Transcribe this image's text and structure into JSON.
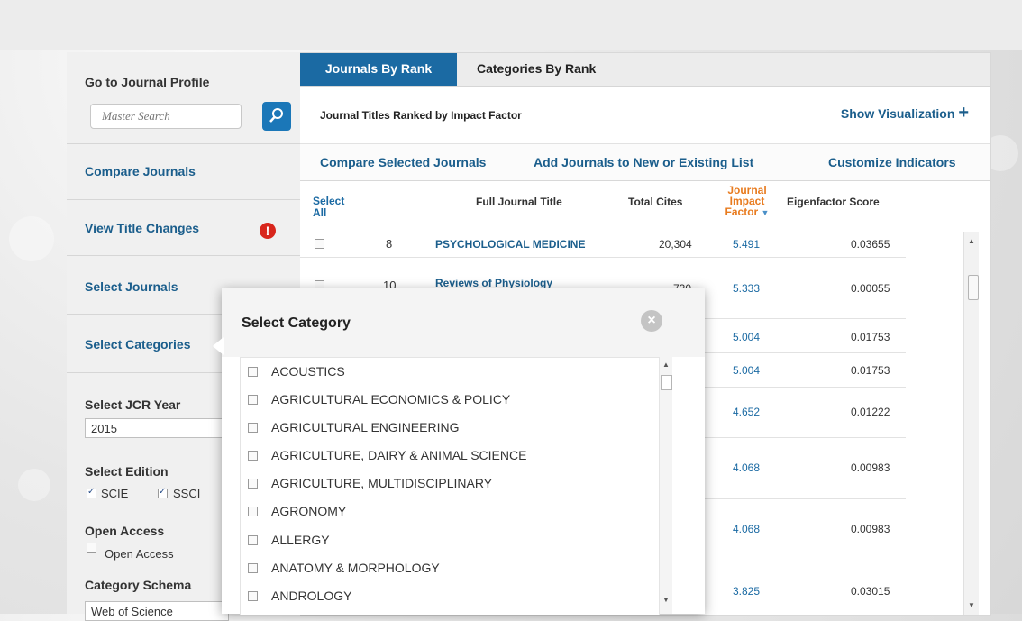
{
  "sidebar": {
    "go_to_profile": "Go to Journal Profile",
    "search_placeholder": "Master Search",
    "compare_journals": "Compare Journals",
    "view_title_changes": "View Title Changes",
    "select_journals": "Select Journals",
    "select_categories": "Select Categories",
    "jcr_year_label": "Select JCR Year",
    "jcr_year_value": "2015",
    "edition_label": "Select Edition",
    "editions": [
      {
        "label": "SCIE",
        "checked": true
      },
      {
        "label": "SSCI",
        "checked": true
      }
    ],
    "open_access_label": "Open Access",
    "open_access_option": "Open Access",
    "category_schema_label": "Category Schema",
    "category_schema_value": "Web of Science"
  },
  "tabs": {
    "active": "Journals By Rank",
    "other": "Categories By Rank"
  },
  "subtitle": "Journal Titles Ranked by Impact Factor",
  "show_visualization": "Show Visualization",
  "actions": {
    "compare": "Compare Selected Journals",
    "add": "Add Journals to New or Existing List",
    "customize": "Customize Indicators"
  },
  "table": {
    "headers": {
      "select": "Select",
      "all": "All",
      "title": "Full Journal Title",
      "cites": "Total Cites",
      "jif_line1": "Journal",
      "jif_line2": "Impact",
      "jif_line3": "Factor",
      "eigen": "Eigenfactor Score"
    },
    "rows": [
      {
        "rank": "8",
        "title": "PSYCHOLOGICAL MEDICINE",
        "cites": "20,304",
        "jif": "5.491",
        "eigen": "0.03655"
      },
      {
        "rank": "10",
        "title": "Reviews of Physiology",
        "cites": "730",
        "jif": "5.333",
        "eigen": "0.00055"
      },
      {
        "rank": "",
        "title": "",
        "cites": "",
        "jif": "5.004",
        "eigen": "0.01753"
      },
      {
        "rank": "",
        "title": "",
        "cites": "",
        "jif": "5.004",
        "eigen": "0.01753"
      },
      {
        "rank": "",
        "title": "",
        "cites": "",
        "jif": "4.652",
        "eigen": "0.01222"
      },
      {
        "rank": "",
        "title": "",
        "cites": "",
        "jif": "4.068",
        "eigen": "0.00983"
      },
      {
        "rank": "",
        "title": "",
        "cites": "",
        "jif": "4.068",
        "eigen": "0.00983"
      },
      {
        "rank": "",
        "title": "",
        "cites": "",
        "jif": "3.825",
        "eigen": "0.03015"
      }
    ]
  },
  "modal": {
    "title": "Select Category",
    "close_icon": "×",
    "categories": [
      "ACOUSTICS",
      "AGRICULTURAL ECONOMICS & POLICY",
      "AGRICULTURAL ENGINEERING",
      "AGRICULTURE, DAIRY & ANIMAL SCIENCE",
      "AGRICULTURE, MULTIDISCIPLINARY",
      "AGRONOMY",
      "ALLERGY",
      "ANATOMY & MORPHOLOGY",
      "ANDROLOGY"
    ]
  },
  "colors": {
    "brand_blue": "#1b6aa3",
    "link_blue": "#1b5e8c",
    "alert_red": "#d8261c",
    "jif_orange": "#e87b1f"
  }
}
